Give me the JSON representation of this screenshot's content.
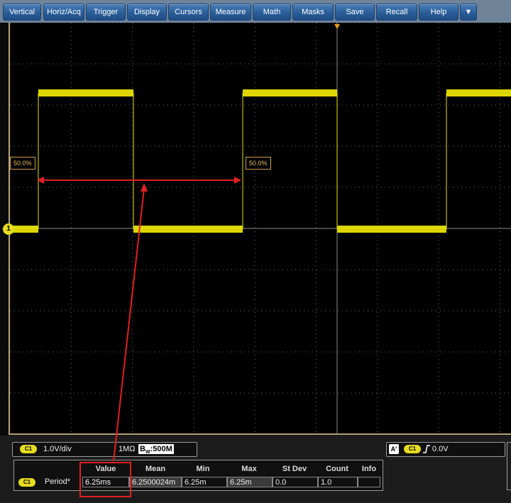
{
  "menu": {
    "items": [
      {
        "label": "Vertical",
        "icon": ""
      },
      {
        "label": "Horiz/Acq",
        "icon": ""
      },
      {
        "label": "Trigger",
        "icon": ""
      },
      {
        "label": "Display",
        "icon": ""
      },
      {
        "label": "Cursors",
        "icon": ""
      },
      {
        "label": "Measure",
        "icon": ""
      },
      {
        "label": "Math",
        "icon": ""
      },
      {
        "label": "Masks",
        "icon": ""
      },
      {
        "label": "Save",
        "icon": ""
      },
      {
        "label": "Recall",
        "icon": ""
      },
      {
        "label": "Help",
        "icon": ""
      },
      {
        "label": "▼",
        "icon": "dropdown-arrow-icon"
      }
    ]
  },
  "waveform": {
    "channel_marker": "1",
    "ref_left_label": "50.0%",
    "ref_right_label": "50.0%",
    "trace_color": "#e8e000",
    "annotation_color": "#e02020"
  },
  "channel_settings": {
    "channel_tag": "C1",
    "volts_per_div": "1.0V/div",
    "impedance": "1MΩ",
    "bw_prefix": "B",
    "bw_sub": "W",
    "bw_value": ":500M"
  },
  "trigger_readout": {
    "mode_tag": "A'",
    "channel_tag": "C1",
    "slope_icon": "rising-edge-icon",
    "level": "0.0V"
  },
  "measurements": {
    "headers": [
      "Value",
      "Mean",
      "Min",
      "Max",
      "St Dev",
      "Count",
      "Info"
    ],
    "row": {
      "channel_tag": "C1",
      "name": "Period*",
      "value": "6.25ms",
      "mean": "6.2500024m",
      "min": "6.25m",
      "max": "6.25m",
      "stdev": "0.0",
      "count": "1.0",
      "info": ""
    }
  }
}
